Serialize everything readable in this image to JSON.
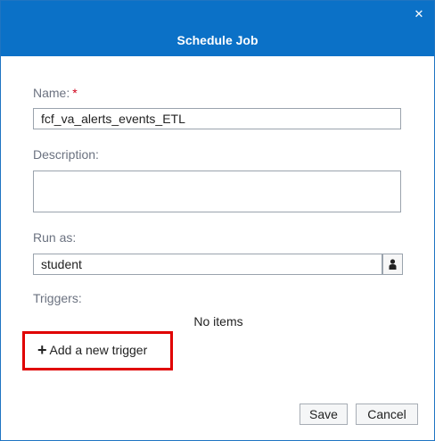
{
  "dialog": {
    "title": "Schedule Job",
    "close_glyph": "✕"
  },
  "form": {
    "name_label": "Name:",
    "required_mark": "*",
    "name_value": "fcf_va_alerts_events_ETL",
    "description_label": "Description:",
    "description_value": "",
    "run_as_label": "Run as:",
    "run_as_value": "student",
    "triggers_label": "Triggers:",
    "no_items_text": "No items",
    "add_trigger_label": "Add a new trigger",
    "add_trigger_glyph": "+"
  },
  "footer": {
    "save_label": "Save",
    "cancel_label": "Cancel"
  },
  "icons": {
    "close": "close-icon",
    "user": "user-icon",
    "plus": "plus-icon"
  },
  "colors": {
    "titlebar": "#0b71c7",
    "required": "#d0021b",
    "highlight": "#e00000"
  }
}
